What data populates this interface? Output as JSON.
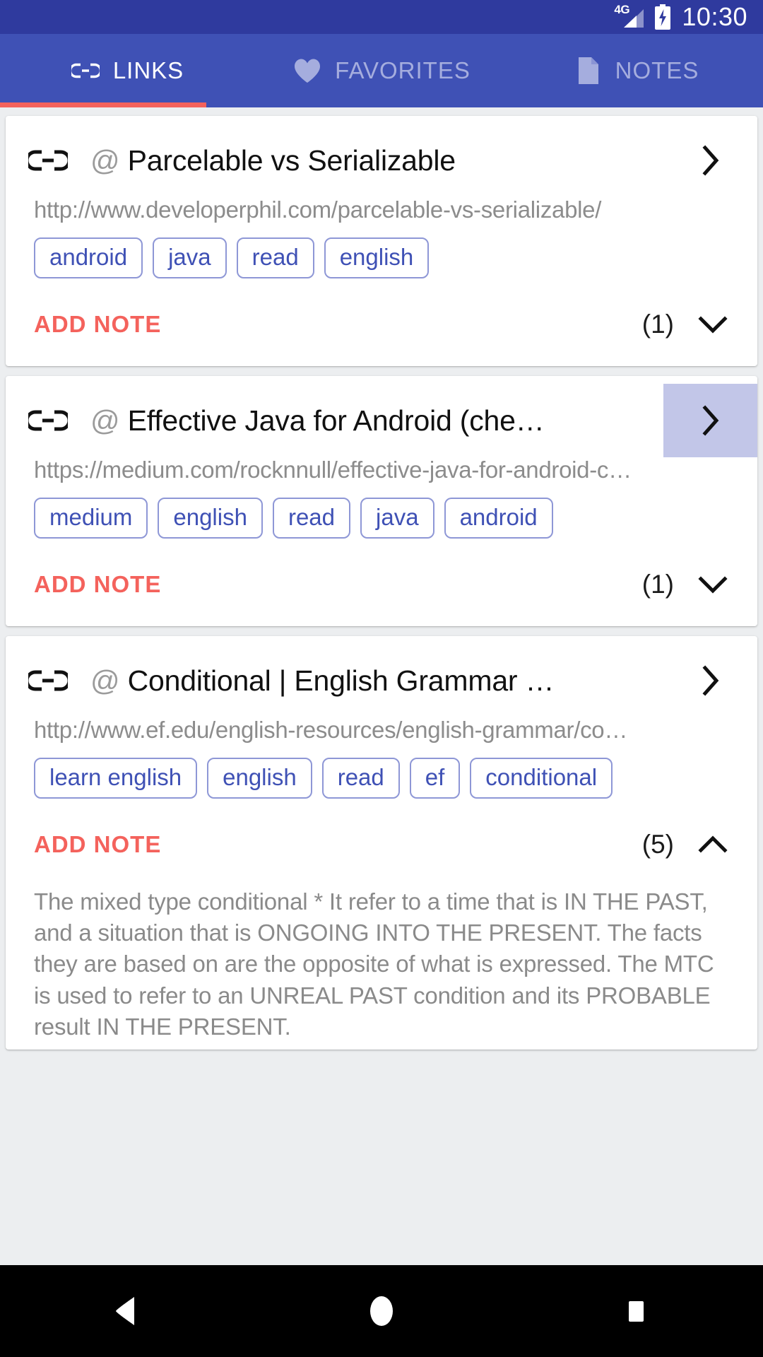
{
  "statusbar": {
    "network_label": "4G",
    "time": "10:30",
    "signal_icon": "signal-bars-icon",
    "battery_icon": "battery-charging-icon",
    "background_color": "#2f3a9e"
  },
  "tabs": {
    "accent_color": "#3f51b5",
    "indicator_color": "#f4625c",
    "items": [
      {
        "label": "LINKS",
        "icon": "link-icon",
        "active": true
      },
      {
        "label": "FAVORITES",
        "icon": "heart-icon",
        "active": false
      },
      {
        "label": "NOTES",
        "icon": "document-icon",
        "active": false
      }
    ]
  },
  "cards": [
    {
      "icon": "link-icon",
      "at_symbol": "@",
      "title": "Parcelable vs Serializable",
      "url": "http://www.developerphil.com/parcelable-vs-serializable/",
      "tags": [
        "android",
        "java",
        "read",
        "english"
      ],
      "add_note_label": "ADD NOTE",
      "note_count": "(1)",
      "expanded": false,
      "chevron_icon": "chevron-right-icon",
      "expand_icon": "chevron-down-icon",
      "chevron_pressed": false,
      "note_text": ""
    },
    {
      "icon": "link-icon",
      "at_symbol": "@",
      "title": "Effective Java for Android (che…",
      "url": "https://medium.com/rocknnull/effective-java-for-android-c…",
      "tags": [
        "medium",
        "english",
        "read",
        "java",
        "android"
      ],
      "add_note_label": "ADD NOTE",
      "note_count": "(1)",
      "expanded": false,
      "chevron_icon": "chevron-right-icon",
      "expand_icon": "chevron-down-icon",
      "chevron_pressed": true,
      "note_text": ""
    },
    {
      "icon": "link-icon",
      "at_symbol": "@",
      "title": "Conditional | English Grammar …",
      "url": "http://www.ef.edu/english-resources/english-grammar/co…",
      "tags": [
        "learn english",
        "english",
        "read",
        "ef",
        "conditional"
      ],
      "add_note_label": "ADD NOTE",
      "note_count": "(5)",
      "expanded": true,
      "chevron_icon": "chevron-right-icon",
      "expand_icon": "chevron-up-icon",
      "chevron_pressed": false,
      "note_text": "The mixed type conditional\n* It refer to a time that is IN THE PAST, and a situation that is ONGOING INTO THE PRESENT. The facts they are based on are the opposite of what is expressed. The MTC is used to refer to an UNREAL PAST condition and its PROBABLE result IN THE PRESENT."
    }
  ],
  "navbar": {
    "back_label": "back-button",
    "home_label": "home-button",
    "recents_label": "recents-button"
  },
  "colors": {
    "card_background": "#ffffff",
    "page_background": "#eceef0",
    "tag_border": "#8e97d6",
    "tag_text": "#3f51b5",
    "accent_red": "#f4625c",
    "pressed_highlight": "#c2c6e8"
  }
}
